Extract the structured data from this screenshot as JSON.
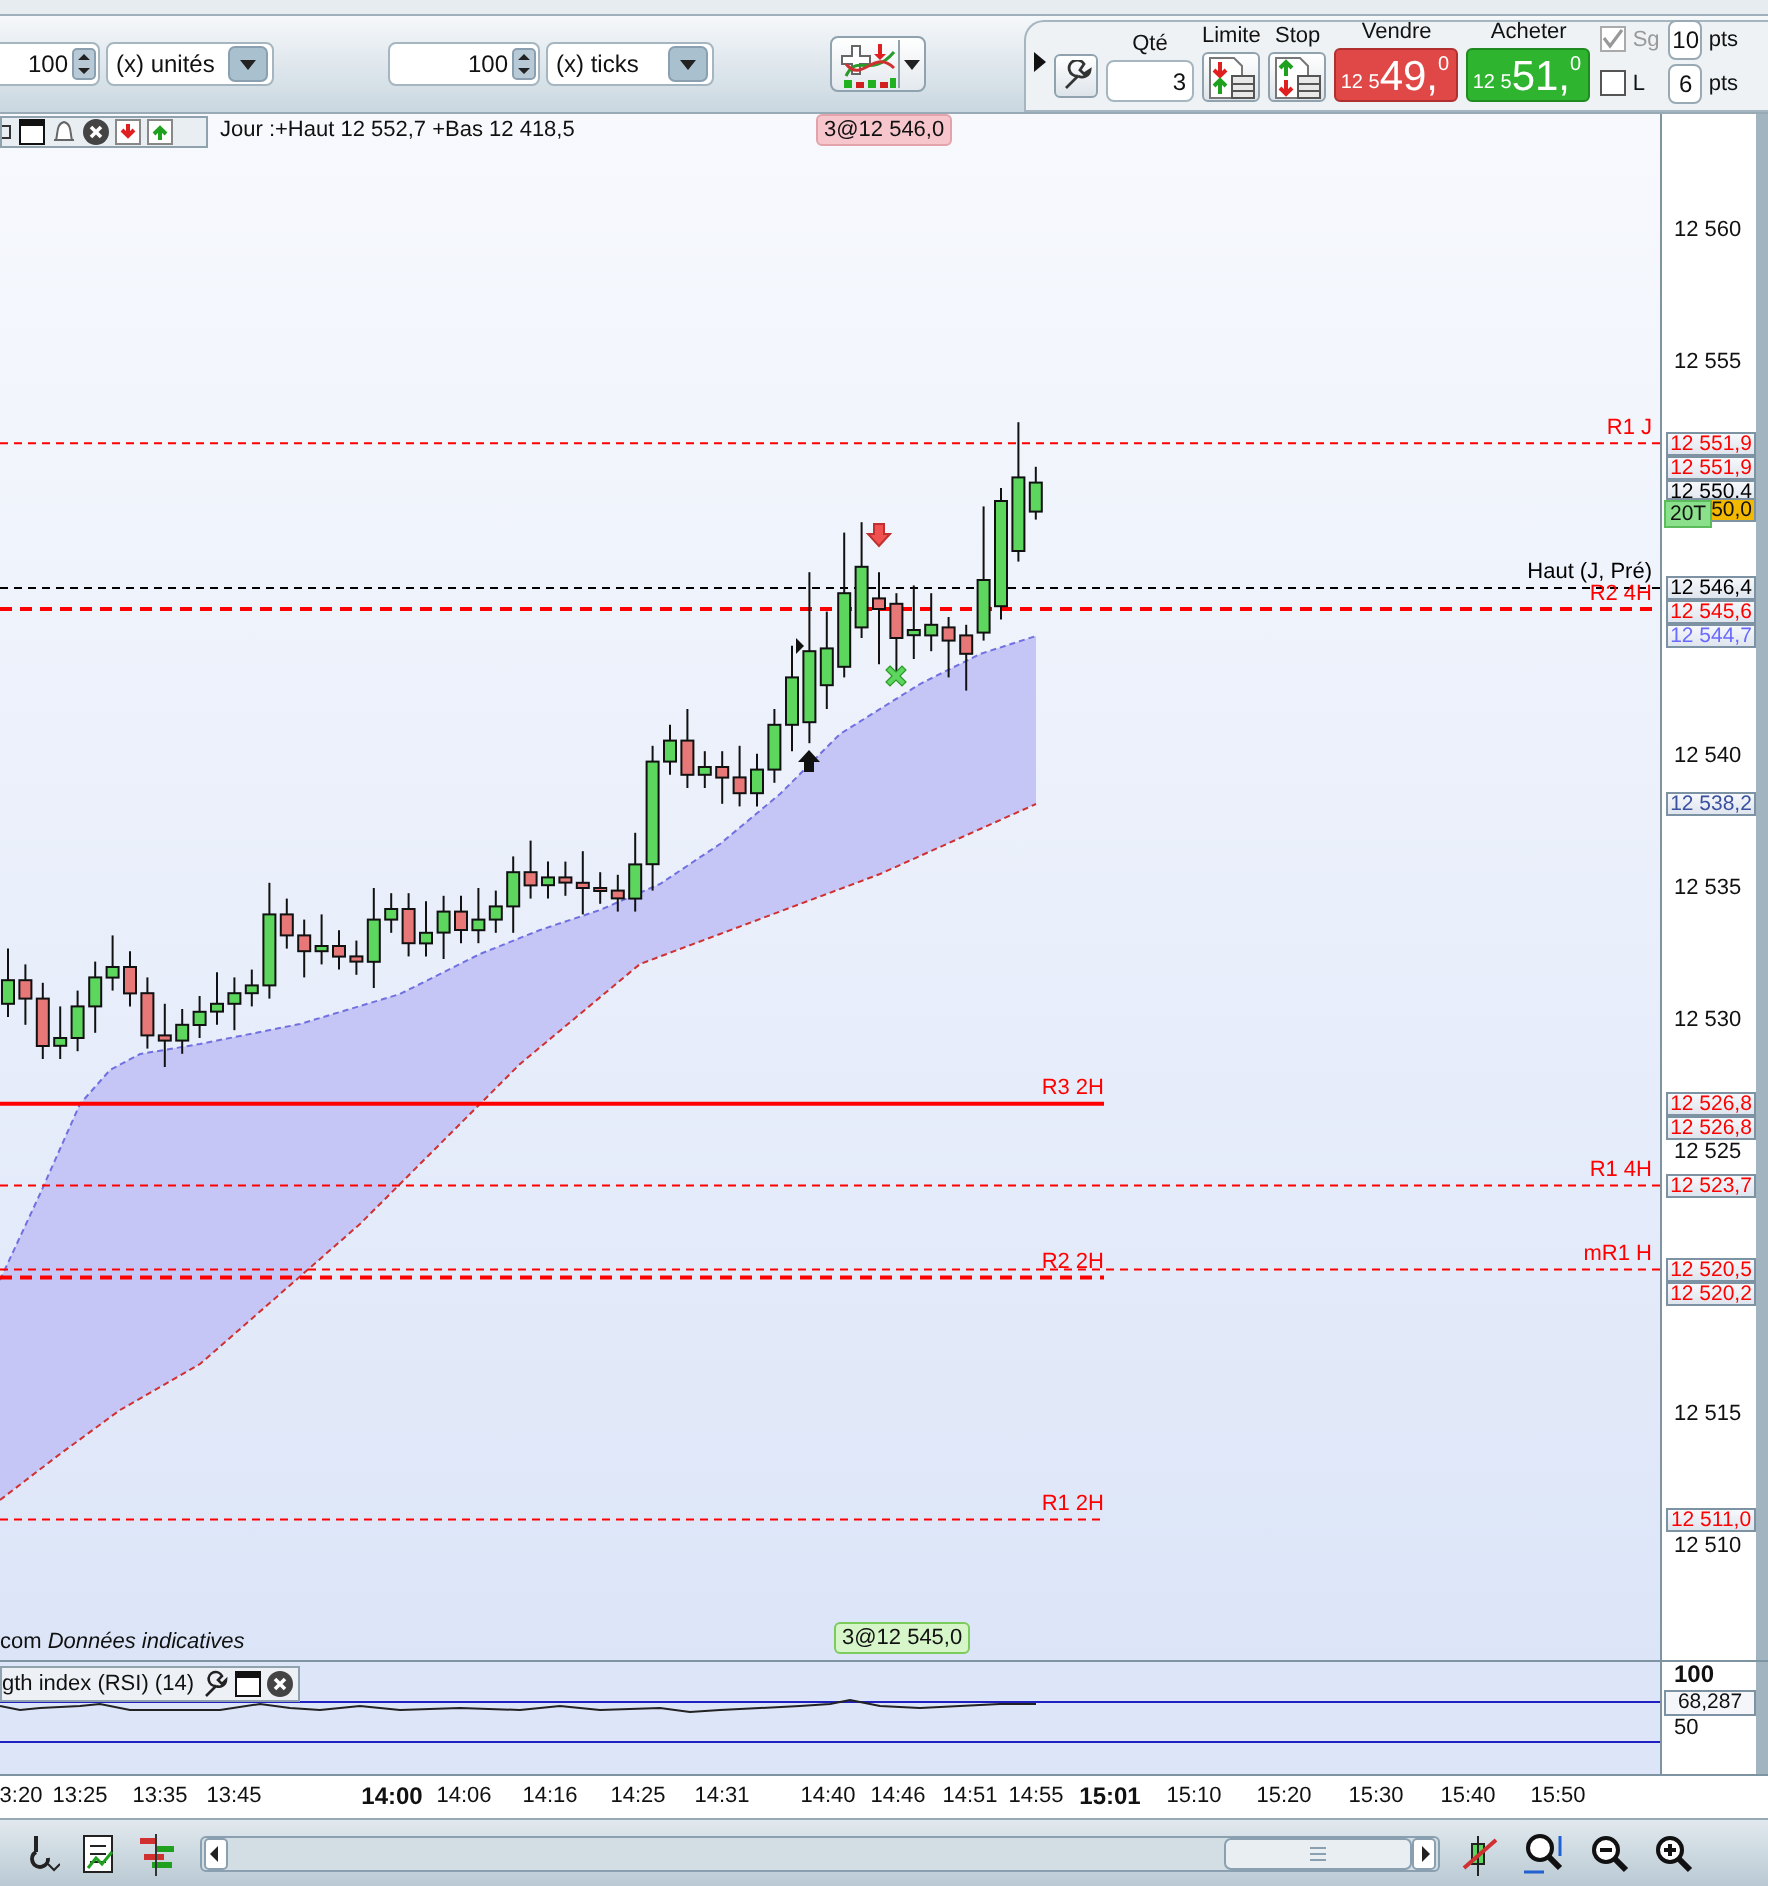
{
  "order_bar": {
    "quantity": {
      "value": "100",
      "unit": "(x) unités"
    },
    "offset": {
      "value": "100",
      "unit": "(x) ticks"
    }
  },
  "trade_panel": {
    "quantity_label": "Qté",
    "quantity": "3",
    "limit_label": "Limite",
    "stop_label": "Stop",
    "sell": {
      "label": "Vendre",
      "prefix": "12 5",
      "main": "49,",
      "decimal": "0"
    },
    "buy": {
      "label": "Acheter",
      "prefix": "12 5",
      "main": "51,",
      "decimal": "0"
    },
    "options": [
      {
        "label": "Sg",
        "checked": true,
        "disabled": true,
        "points": "10",
        "unit": "pts"
      },
      {
        "label": "L",
        "checked": false,
        "disabled": false,
        "points": "6",
        "unit": "pts"
      }
    ]
  },
  "chart": {
    "header": "Jour :+Haut 12 552,7 +Bas 12 418,5",
    "order_tags": [
      {
        "text": "3@12 546,0",
        "kind": "pending"
      },
      {
        "text": "3@12 545,0",
        "kind": "filled"
      }
    ],
    "footnote": "com *Données indicatives*",
    "levels": [
      {
        "label": "R1 J",
        "tag": "12 551,9",
        "color": "#ff0000",
        "kind": "dashed",
        "full_width": true
      },
      {
        "label": "Haut (J, Pré)",
        "tag": "12 546,4",
        "color": "#000000",
        "kind": "dashed",
        "full_width": true
      },
      {
        "label": "R2 4H",
        "tag": "12 545,6",
        "color": "#ff0000",
        "kind": "bold-dashed",
        "full_width": true
      },
      {
        "label": "R3 2H",
        "tag": "12 526,8",
        "color": "#ff0000",
        "kind": "solid",
        "full_width": false
      },
      {
        "label": "R1 4H",
        "tag": "12 523,7",
        "color": "#ff0000",
        "kind": "dashed",
        "full_width": true
      },
      {
        "label": "mR1 H",
        "tag": "12 520,5",
        "color": "#ff0000",
        "kind": "dashed",
        "full_width": true
      },
      {
        "label": "R2 2H",
        "tag": "12 520,2",
        "color": "#ff0000",
        "kind": "bold-dashed",
        "full_width": false
      },
      {
        "label": "R1 2H",
        "tag": "12 511,0",
        "color": "#ff0000",
        "kind": "dashed",
        "full_width": false
      }
    ],
    "price_ticks": [
      "12 560",
      "12 555",
      "12 540",
      "12 535",
      "12 530",
      "12 525",
      "12 515",
      "12 510"
    ],
    "price_tags": [
      {
        "kind": "tag",
        "text": "12 551,9",
        "color": "#ff0000"
      },
      {
        "kind": "tag",
        "text": "12 550,4",
        "color": "#000000"
      },
      {
        "kind": "timer",
        "label": "20T",
        "text": "50,0"
      },
      {
        "kind": "tag",
        "text": "12 544,7",
        "color": "#6a6aff"
      },
      {
        "kind": "tag",
        "text": "12 538,2",
        "color": "#3a50a0"
      },
      {
        "kind": "tag",
        "text": "12 526,8",
        "color": "#ff0000"
      }
    ]
  },
  "rsi_panel": {
    "title": "gth index (RSI) (14)",
    "ticks": [
      "100",
      "50"
    ],
    "reading": "68,287"
  },
  "time_axis": [
    {
      "label": "3:20",
      "bold": false
    },
    {
      "label": "13:25",
      "bold": false
    },
    {
      "label": "13:35",
      "bold": false
    },
    {
      "label": "13:45",
      "bold": false
    },
    {
      "label": "14:00",
      "bold": true
    },
    {
      "label": "14:06",
      "bold": false
    },
    {
      "label": "14:16",
      "bold": false
    },
    {
      "label": "14:25",
      "bold": false
    },
    {
      "label": "14:31",
      "bold": false
    },
    {
      "label": "14:40",
      "bold": false
    },
    {
      "label": "14:46",
      "bold": false
    },
    {
      "label": "14:51",
      "bold": false
    },
    {
      "label": "14:55",
      "bold": false
    },
    {
      "label": "15:01",
      "bold": true
    },
    {
      "label": "15:10",
      "bold": false
    },
    {
      "label": "15:20",
      "bold": false
    },
    {
      "label": "15:30",
      "bold": false
    },
    {
      "label": "15:40",
      "bold": false
    },
    {
      "label": "15:50",
      "bold": false
    }
  ]
}
